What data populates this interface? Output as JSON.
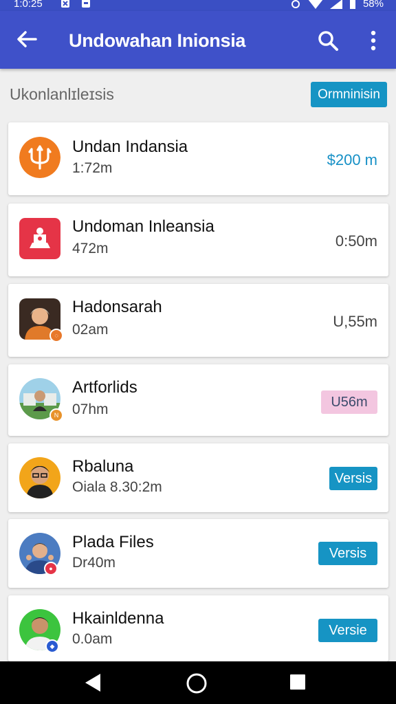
{
  "status": {
    "time": "1:0:25",
    "battery": "58%"
  },
  "appbar": {
    "title": "Undowahan Inionsia"
  },
  "section": {
    "label": "Ukonlanlɪleɪsis",
    "button": "Ormninisin"
  },
  "items": [
    {
      "name": "Undan Indansia",
      "sub": "1:72m",
      "tail": "$200 m"
    },
    {
      "name": "Undoman Inleansia",
      "sub": "472m",
      "tail": "0:50m"
    },
    {
      "name": "Hadonsarah",
      "sub": "02am",
      "tail": "U,55m"
    },
    {
      "name": "Artforlids",
      "sub": "07hm",
      "tail": "U56m"
    },
    {
      "name": "Rbaluna",
      "sub": "Oiala 8.30:2m",
      "tail": "Versis"
    },
    {
      "name": "Plada Files",
      "sub": "Dr40m",
      "tail": "Versis"
    },
    {
      "name": "Hkainldenna",
      "sub": "0.0am",
      "tail": "Versie"
    }
  ],
  "colors": {
    "appbar": "#3f51c9",
    "accent": "#1694c4",
    "pink_pill": "#f3c6e0"
  }
}
